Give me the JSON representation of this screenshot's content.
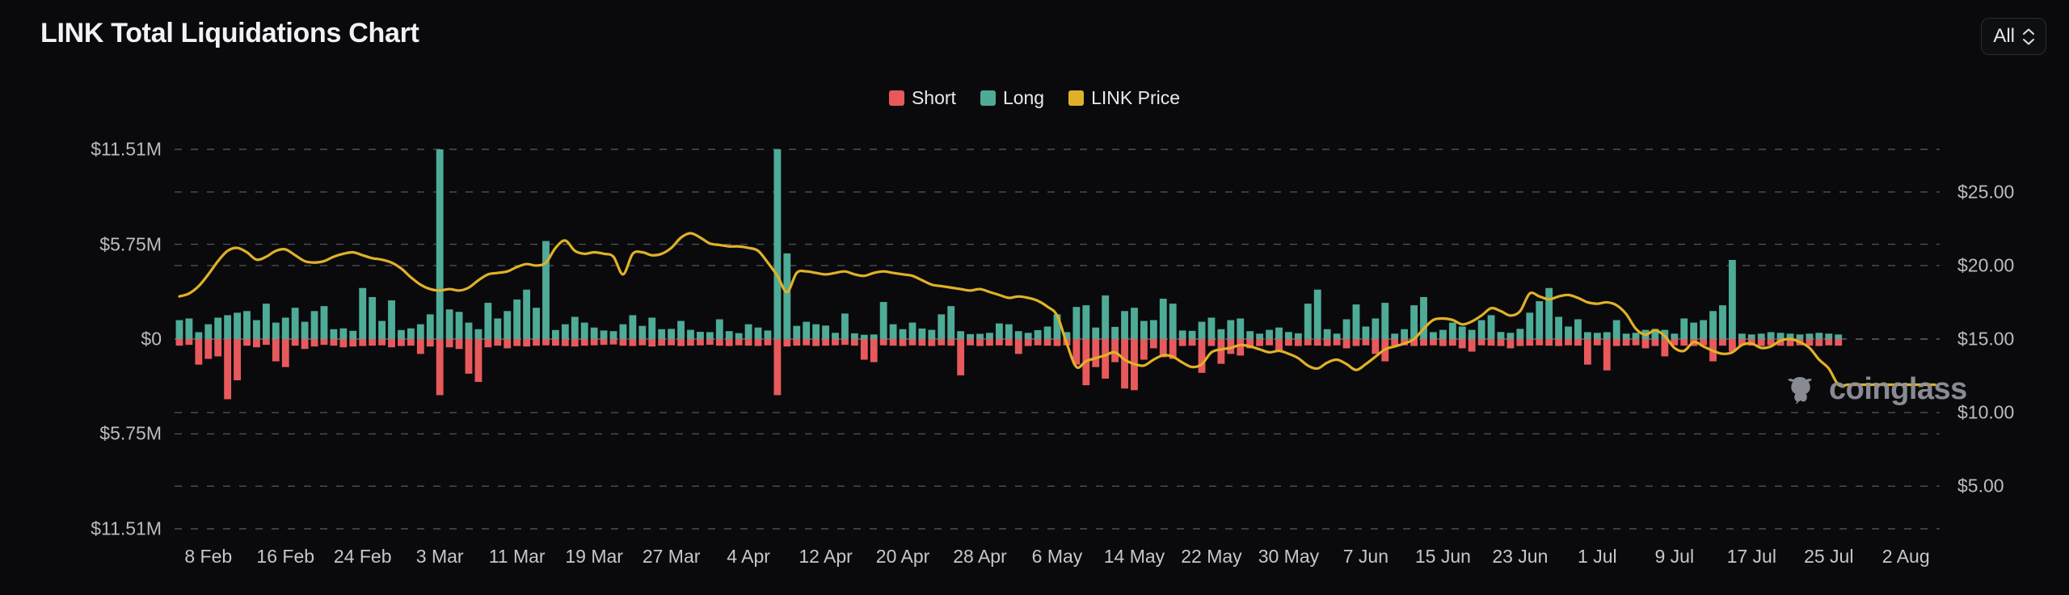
{
  "header": {
    "title": "LINK Total Liquidations Chart",
    "range_selector": {
      "value": "All",
      "icon": "chevron-updown-icon"
    }
  },
  "legend": [
    {
      "label": "Short",
      "color": "#e8595c",
      "icon": "legend-swatch-short"
    },
    {
      "label": "Long",
      "color": "#4eab97",
      "icon": "legend-swatch-long"
    },
    {
      "label": "LINK Price",
      "color": "#e0b game"
    }
  ],
  "watermark": {
    "text": "coinglass",
    "icon": "bull-logo-icon",
    "color": "#8f9299"
  },
  "chart_data": {
    "type": "bar",
    "title": "LINK Total Liquidations Chart",
    "xlabel": "",
    "ylabel": "",
    "grid": true,
    "legend_position": "top-center",
    "background": "#0a0a0c",
    "left_axis": {
      "title": "Liquidations (USD)",
      "ticks": [
        "$11.51M",
        "$5.75M",
        "$0",
        "$5.75M",
        "$11.51M"
      ],
      "tick_values": [
        11510000,
        5750000,
        0,
        -5750000,
        -11510000
      ],
      "ylim": [
        -11510000,
        11510000
      ]
    },
    "right_axis": {
      "title": "LINK Price (USD)",
      "ticks": [
        "$25.00",
        "$20.00",
        "$15.00",
        "$10.00",
        "$5.00"
      ],
      "tick_values": [
        25,
        20,
        15,
        10,
        5
      ],
      "ylim": [
        2.1,
        27.9
      ]
    },
    "x_tick_labels": [
      "8 Feb",
      "16 Feb",
      "24 Feb",
      "3 Mar",
      "11 Mar",
      "19 Mar",
      "27 Mar",
      "4 Apr",
      "12 Apr",
      "20 Apr",
      "28 Apr",
      "6 May",
      "14 May",
      "22 May",
      "30 May",
      "7 Jun",
      "15 Jun",
      "23 Jun",
      "1 Jul",
      "9 Jul",
      "17 Jul",
      "25 Jul",
      "2 Aug"
    ],
    "x_tick_index": [
      3,
      11,
      19,
      27,
      35,
      43,
      51,
      59,
      67,
      75,
      83,
      91,
      99,
      107,
      115,
      123,
      131,
      139,
      147,
      155,
      163,
      171,
      179
    ],
    "n_points": 183,
    "series": [
      {
        "name": "Long",
        "type": "bar",
        "color": "#4eab97",
        "axis": "left",
        "unit": "USD",
        "values": [
          1150000,
          1250000,
          420000,
          900000,
          1300000,
          1450000,
          1600000,
          1700000,
          1150000,
          2150000,
          1000000,
          1300000,
          1900000,
          1050000,
          1700000,
          2000000,
          600000,
          650000,
          500000,
          3100000,
          2550000,
          1100000,
          2350000,
          550000,
          650000,
          900000,
          1500000,
          11510000,
          1800000,
          1650000,
          1000000,
          600000,
          2200000,
          1250000,
          1700000,
          2400000,
          3000000,
          1900000,
          5950000,
          550000,
          900000,
          1350000,
          1000000,
          700000,
          520000,
          480000,
          900000,
          1450000,
          800000,
          1300000,
          600000,
          620000,
          1100000,
          560000,
          440000,
          420000,
          1200000,
          480000,
          360000,
          900000,
          700000,
          520000,
          11510000,
          5200000,
          800000,
          1050000,
          900000,
          820000,
          380000,
          1550000,
          350000,
          260000,
          280000,
          2250000,
          900000,
          600000,
          1000000,
          640000,
          560000,
          1500000,
          2000000,
          480000,
          300000,
          320000,
          380000,
          950000,
          900000,
          480000,
          380000,
          540000,
          760000,
          1500000,
          420000,
          1950000,
          2050000,
          700000,
          2650000,
          740000,
          1700000,
          1900000,
          1100000,
          1150000,
          2450000,
          2150000,
          520000,
          500000,
          1050000,
          1300000,
          600000,
          1150000,
          1250000,
          480000,
          330000,
          560000,
          700000,
          430000,
          350000,
          2150000,
          3000000,
          600000,
          330000,
          1200000,
          2100000,
          760000,
          1250000,
          2200000,
          330000,
          600000,
          2050000,
          2550000,
          420000,
          560000,
          1000000,
          760000,
          560000,
          1150000,
          1450000,
          430000,
          380000,
          620000,
          1600000,
          2300000,
          3100000,
          1350000,
          760000,
          1200000,
          420000,
          380000,
          420000,
          1150000,
          330000,
          380000,
          560000,
          620000,
          560000,
          330000,
          1250000,
          1000000,
          1150000,
          1700000,
          2050000,
          4800000,
          330000,
          280000,
          330000,
          420000,
          380000,
          330000,
          280000,
          330000,
          380000,
          330000,
          280000
        ]
      },
      {
        "name": "Short",
        "type": "bar",
        "color": "#e8595c",
        "axis": "left",
        "unit": "USD",
        "values": [
          -400000,
          -350000,
          -1550000,
          -1200000,
          -1050000,
          -3650000,
          -2500000,
          -400000,
          -500000,
          -350000,
          -1350000,
          -1700000,
          -400000,
          -600000,
          -450000,
          -350000,
          -400000,
          -500000,
          -450000,
          -420000,
          -400000,
          -380000,
          -500000,
          -420000,
          -400000,
          -900000,
          -450000,
          -3400000,
          -500000,
          -600000,
          -2100000,
          -2600000,
          -500000,
          -400000,
          -560000,
          -420000,
          -450000,
          -400000,
          -380000,
          -400000,
          -420000,
          -450000,
          -400000,
          -380000,
          -350000,
          -330000,
          -400000,
          -420000,
          -380000,
          -450000,
          -400000,
          -380000,
          -420000,
          -400000,
          -380000,
          -350000,
          -400000,
          -420000,
          -380000,
          -400000,
          -420000,
          -380000,
          -3400000,
          -450000,
          -400000,
          -380000,
          -420000,
          -400000,
          -380000,
          -350000,
          -400000,
          -1250000,
          -1400000,
          -380000,
          -400000,
          -420000,
          -380000,
          -400000,
          -420000,
          -380000,
          -400000,
          -2200000,
          -380000,
          -420000,
          -400000,
          -380000,
          -400000,
          -900000,
          -420000,
          -380000,
          -400000,
          -420000,
          -380000,
          -1550000,
          -2800000,
          -1700000,
          -2400000,
          -1400000,
          -3000000,
          -3100000,
          -1250000,
          -560000,
          -1100000,
          -1200000,
          -420000,
          -400000,
          -2050000,
          -420000,
          -1500000,
          -900000,
          -1000000,
          -560000,
          -420000,
          -380000,
          -760000,
          -400000,
          -420000,
          -380000,
          -400000,
          -420000,
          -380000,
          -560000,
          -420000,
          -380000,
          -900000,
          -1350000,
          -400000,
          -380000,
          -420000,
          -400000,
          -380000,
          -420000,
          -400000,
          -560000,
          -760000,
          -380000,
          -400000,
          -420000,
          -560000,
          -420000,
          -400000,
          -380000,
          -400000,
          -420000,
          -380000,
          -400000,
          -1550000,
          -380000,
          -1900000,
          -420000,
          -400000,
          -380000,
          -560000,
          -420000,
          -1050000,
          -380000,
          -400000,
          -420000,
          -380000,
          -1350000,
          -400000,
          -760000,
          -380000,
          -400000,
          -420000,
          -380000,
          -400000,
          -420000,
          -380000,
          -400000,
          -420000,
          -380000,
          -400000
        ]
      },
      {
        "name": "LINK Price",
        "type": "line",
        "color": "#e0b128",
        "axis": "right",
        "unit": "USD",
        "values": [
          17.9,
          18.1,
          18.6,
          19.4,
          20.3,
          21.0,
          21.2,
          20.9,
          20.4,
          20.6,
          21.0,
          21.1,
          20.7,
          20.3,
          20.2,
          20.3,
          20.6,
          20.8,
          20.9,
          20.7,
          20.5,
          20.4,
          20.2,
          19.8,
          19.2,
          18.7,
          18.4,
          18.3,
          18.4,
          18.3,
          18.5,
          19.0,
          19.4,
          19.5,
          19.6,
          19.9,
          20.1,
          20.0,
          20.2,
          21.2,
          21.7,
          21.0,
          20.8,
          20.9,
          20.8,
          20.6,
          19.4,
          20.8,
          20.9,
          20.7,
          20.8,
          21.2,
          21.9,
          22.2,
          21.9,
          21.5,
          21.4,
          21.3,
          21.3,
          21.2,
          21.0,
          20.2,
          19.3,
          18.2,
          19.5,
          19.6,
          19.5,
          19.4,
          19.5,
          19.6,
          19.4,
          19.3,
          19.5,
          19.6,
          19.5,
          19.4,
          19.3,
          19.0,
          18.7,
          18.6,
          18.5,
          18.4,
          18.3,
          18.4,
          18.2,
          18.0,
          17.8,
          17.9,
          17.8,
          17.6,
          17.2,
          16.6,
          14.7,
          13.1,
          13.5,
          13.7,
          13.9,
          14.1,
          13.6,
          13.3,
          13.2,
          13.6,
          13.9,
          13.8,
          13.4,
          13.1,
          13.3,
          14.1,
          14.3,
          14.4,
          14.6,
          14.5,
          14.3,
          14.1,
          14.2,
          14.0,
          13.7,
          13.2,
          13.0,
          13.4,
          13.6,
          13.3,
          12.9,
          13.3,
          13.8,
          14.3,
          14.5,
          14.7,
          15.0,
          15.7,
          16.3,
          16.4,
          16.3,
          16.0,
          16.2,
          16.6,
          17.1,
          16.9,
          16.6,
          16.9,
          18.1,
          17.9,
          17.7,
          17.9,
          18.0,
          17.8,
          17.5,
          17.4,
          17.5,
          17.3,
          16.7,
          15.7,
          15.3,
          15.6,
          15.2,
          14.4,
          14.2,
          14.8,
          14.5,
          14.2,
          14.0,
          14.1,
          14.6,
          14.7,
          14.4,
          14.5,
          14.9,
          15.0,
          14.8,
          14.4,
          13.6,
          13.0,
          11.9
        ]
      }
    ]
  }
}
